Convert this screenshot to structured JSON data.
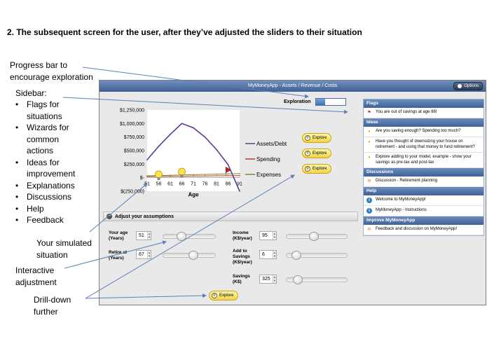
{
  "heading": "2.   The subsequent screen for the user, after they’ve adjusted the sliders to their situation",
  "annotations": {
    "progress": [
      "Progress bar to",
      "encourage exploration"
    ],
    "sidebar_title": "Sidebar:",
    "sidebar_list": [
      "Flags for",
      "situations",
      "Wizards for",
      "common",
      "actions",
      "Ideas for",
      "improvement",
      "Explanations",
      "Discussions",
      "Help",
      "Feedback"
    ],
    "simulated": [
      "Your simulated",
      "situation"
    ],
    "interactive": [
      "Interactive",
      "adjustment"
    ],
    "drilldown": [
      "Drill-down",
      "further"
    ]
  },
  "app": {
    "title": "MyMoneyApp - Assets / Revenue / Costs",
    "options_label": "Options",
    "exploration_label": "Exploration",
    "exploration_progress": 0.33,
    "explore_label": "Explore",
    "assumptions_header": "Adjust your assumptions",
    "fields": {
      "age": {
        "label1": "Your age",
        "label2": "(Years)",
        "value": "51",
        "slider": 0.32
      },
      "retire": {
        "label1": "Retire at",
        "label2": "(Years)",
        "value": "67",
        "slider": 0.6
      },
      "income": {
        "label1": "Income",
        "label2": "(K$/year)",
        "value": "95",
        "slider": 0.45
      },
      "savings_add": {
        "label1": "Add to",
        "label2": "Savings",
        "label3": "(K$/year)",
        "value": "6",
        "slider": 0.1
      },
      "savings": {
        "label1": "Savings",
        "label2": "(K$)",
        "value": "325",
        "slider": 0.12
      }
    }
  },
  "chart_data": {
    "type": "line",
    "xlabel": "Age",
    "ylabel": "",
    "categories": [
      "51",
      "56",
      "61",
      "66",
      "71",
      "76",
      "81",
      "86",
      "91"
    ],
    "y_ticks": [
      "$1,250,000",
      "$1,000,000",
      "$750,000",
      "$500,000",
      "$250,000",
      "$-",
      "$(250,000)"
    ],
    "ylim": [
      -250000,
      1250000
    ],
    "series": [
      {
        "name": "Assets/Debt",
        "color": "#5b3a93",
        "x": [
          51,
          56,
          61,
          66,
          71,
          76,
          81,
          86,
          91
        ],
        "values": [
          330000,
          580000,
          800000,
          1000000,
          920000,
          750000,
          520000,
          240000,
          -250000
        ]
      },
      {
        "name": "Spending",
        "color": "#c0392b",
        "x": [
          51,
          56,
          61,
          66,
          71,
          76,
          81,
          86,
          91
        ],
        "values": [
          20000,
          22000,
          24000,
          25000,
          30000,
          32000,
          34000,
          36000,
          38000
        ]
      },
      {
        "name": "Expenses",
        "color": "#7a8a2a",
        "x": [
          51,
          56,
          61,
          66,
          71,
          76,
          81,
          86,
          91
        ],
        "values": [
          35000,
          40000,
          45000,
          50000,
          55000,
          60000,
          65000,
          70000,
          75000
        ]
      }
    ]
  },
  "sidebar": {
    "flags_header": "Flags",
    "flags": [
      "You are out of savings at age 86!"
    ],
    "ideas_header": "Ideas",
    "ideas": [
      "Are you saving enough? Spending too much?",
      "Have you thought of downsizing your house on retirement - and using that money to fund retirement?",
      "Explore adding to your model, example - show your savings as pre-tax and post-tax"
    ],
    "discussions_header": "Discussions",
    "discussions": [
      "Discussion - Retirement planning"
    ],
    "help_header": "Help",
    "help": [
      "Welcome to MyMoneyApp!",
      "MyMoneyApp - Instructions"
    ],
    "improve_header": "Improve MyMoneyApp",
    "improve": [
      "Feedback and discussion on MyMoneyApp!"
    ]
  }
}
